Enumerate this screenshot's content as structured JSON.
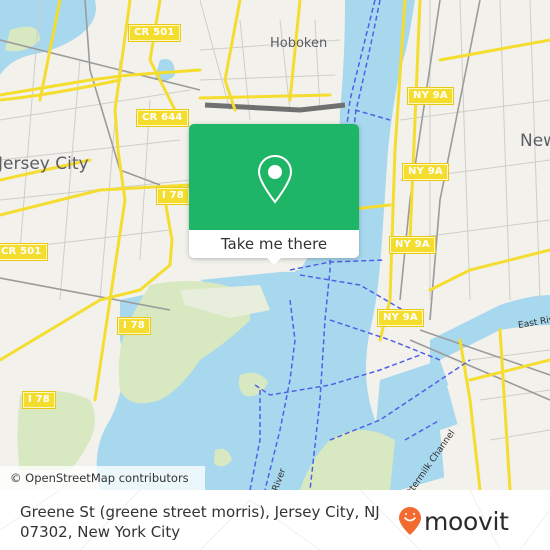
{
  "map": {
    "place_labels": [
      {
        "id": "hoboken",
        "text": "Hoboken",
        "kind": "town"
      },
      {
        "id": "jersey-city",
        "text": "Jersey City",
        "kind": "city"
      },
      {
        "id": "new-york",
        "text": "New",
        "kind": "city"
      }
    ],
    "road_shields": [
      {
        "id": "cr501-top",
        "text": "CR 501"
      },
      {
        "id": "cr644",
        "text": "CR 644"
      },
      {
        "id": "i78-a",
        "text": "I 78"
      },
      {
        "id": "cr501-left",
        "text": "CR 501"
      },
      {
        "id": "i78-b",
        "text": "I 78"
      },
      {
        "id": "i78-c",
        "text": "I 78"
      },
      {
        "id": "ny9a-a",
        "text": "NY 9A"
      },
      {
        "id": "ny9a-b",
        "text": "NY 9A"
      },
      {
        "id": "ny9a-c",
        "text": "NY 9A"
      },
      {
        "id": "ny9a-d",
        "text": "NY 9A"
      }
    ],
    "water_labels": [
      {
        "id": "east-river",
        "text": "East Riv"
      },
      {
        "id": "hudson-river",
        "text": "River"
      },
      {
        "id": "buttermilk-channel",
        "text": "Buttermilk Channel"
      }
    ],
    "attribution": "© OpenStreetMap contributors",
    "colors": {
      "land": "#f2f1ec",
      "water": "#a8d8ee",
      "park": "#d8e8c0",
      "major_road": "#f5dd2f",
      "ferry": "#5060e8",
      "popup_green": "#1fb567"
    }
  },
  "popup": {
    "icon": "location-pin-icon",
    "cta_label": "Take me there"
  },
  "footer": {
    "address": "Greene St (greene street morris), Jersey City, NJ 07302, New York City",
    "brand": "moovit",
    "brand_color": "#f26a2e"
  }
}
